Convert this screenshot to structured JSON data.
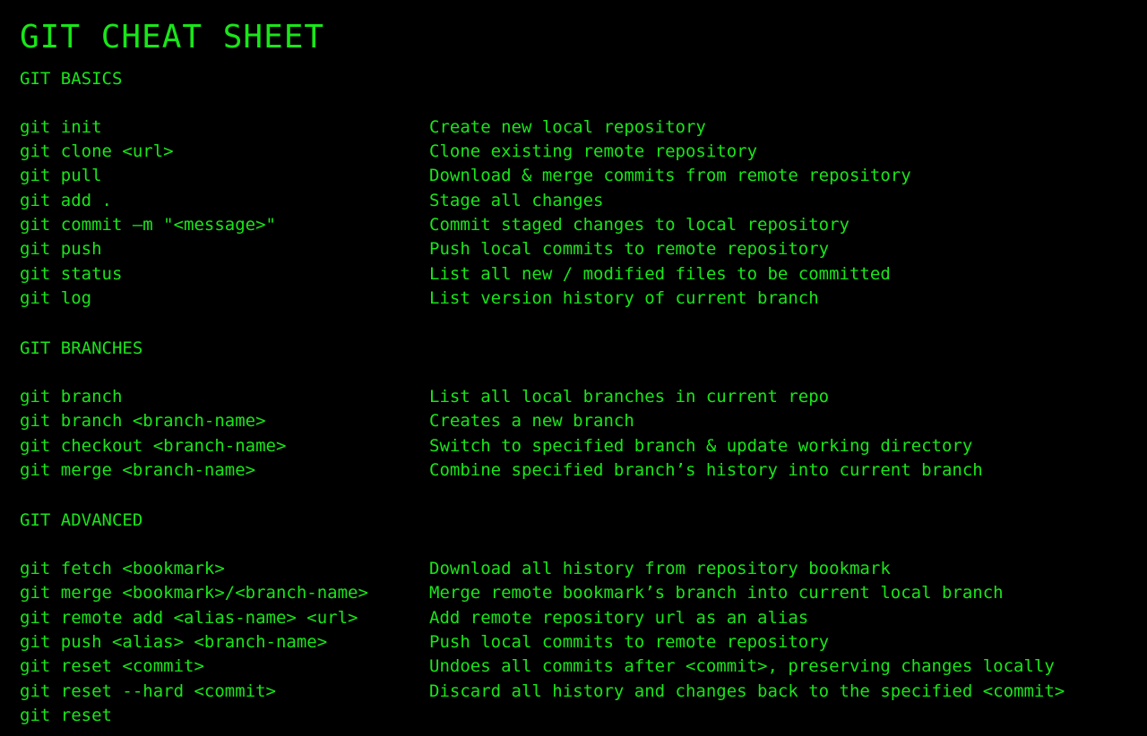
{
  "title": "GIT CHEAT SHEET",
  "accent_color": "#19e619",
  "background_color": "#000000",
  "sections": [
    {
      "heading": "GIT BASICS",
      "rows": [
        {
          "cmd": "git init",
          "desc": "Create new local repository"
        },
        {
          "cmd": "git clone <url>",
          "desc": "Clone existing remote repository"
        },
        {
          "cmd": "git pull",
          "desc": "Download & merge commits from remote repository"
        },
        {
          "cmd": "git add .",
          "desc": "Stage all changes"
        },
        {
          "cmd": "git commit –m \"<message>\"",
          "desc": "Commit staged changes to local repository"
        },
        {
          "cmd": "git push",
          "desc": "Push local commits to remote repository"
        },
        {
          "cmd": "git status",
          "desc": "List all new / modified files to be committed"
        },
        {
          "cmd": "git log",
          "desc": "List version history of current branch"
        }
      ]
    },
    {
      "heading": "GIT BRANCHES",
      "rows": [
        {
          "cmd": "git branch",
          "desc": "List all local branches in current repo"
        },
        {
          "cmd": "git branch <branch-name>",
          "desc": "Creates a new branch"
        },
        {
          "cmd": "git checkout <branch-name>",
          "desc": "Switch to specified branch & update working directory"
        },
        {
          "cmd": "git merge <branch-name>",
          "desc": "Combine specified branch’s history into current branch"
        }
      ]
    },
    {
      "heading": "GIT ADVANCED",
      "rows": [
        {
          "cmd": "git fetch <bookmark>",
          "desc": "Download all history from repository bookmark"
        },
        {
          "cmd": "git merge <bookmark>/<branch-name>",
          "desc": "Merge remote bookmark’s branch into current local branch"
        },
        {
          "cmd": "git remote add <alias-name> <url>",
          "desc": "Add remote repository url as an alias"
        },
        {
          "cmd": "git push <alias> <branch-name>",
          "desc": "Push local commits to remote repository"
        },
        {
          "cmd": "git reset <commit>",
          "desc": "Undoes all commits after <commit>, preserving changes locally"
        },
        {
          "cmd": "git reset --hard <commit>",
          "desc": "Discard all history and changes back to the specified <commit>"
        },
        {
          "cmd": "git reset",
          "desc": ""
        }
      ]
    }
  ]
}
